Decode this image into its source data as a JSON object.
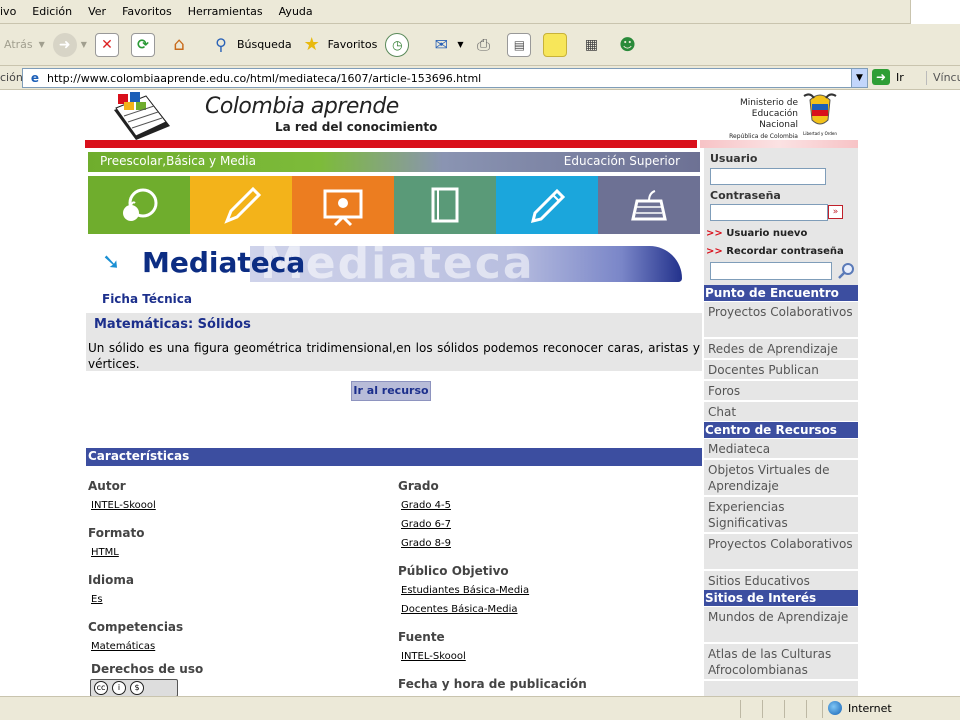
{
  "menu": [
    "ivo",
    "Edición",
    "Ver",
    "Favoritos",
    "Herramientas",
    "Ayuda"
  ],
  "toolbar": {
    "back_label": "Atrás",
    "search_label": "Búsqueda",
    "favorites_label": "Favoritos"
  },
  "address": {
    "label": "ción",
    "url": "http://www.colombiaaprende.edu.co/html/mediateca/1607/article-153696.html",
    "go_label": "Ir",
    "links_label": "Víncul"
  },
  "header": {
    "site_title": "Colombia aprende",
    "site_subtitle": "La red del conocimiento",
    "ministry_lines": [
      "Ministerio de",
      "Educación Nacional",
      "República de Colombia"
    ],
    "crest_caption": "Libertad y Orden"
  },
  "nav": {
    "left_label": "Preescolar,Básica y Media",
    "right_label": "Educación Superior"
  },
  "mediateca_title": "Mediateca",
  "mediateca_ghost": "Mediateca",
  "ficha_label": "Ficha Técnica",
  "resource": {
    "title": "Matemáticas: Sólidos",
    "description": "Un sólido es una figura geométrica tridimensional,en los sólidos podemos reconocer caras, aristas y vértices.",
    "go_button": "Ir al recurso"
  },
  "characteristics": {
    "header": "Características",
    "left": [
      {
        "label": "Autor",
        "values": [
          "INTEL-Skoool"
        ]
      },
      {
        "label": "Formato",
        "values": [
          "HTML"
        ]
      },
      {
        "label": "Idioma",
        "values": [
          "Es"
        ]
      },
      {
        "label": "Competencias",
        "values": [
          "Matemáticas"
        ]
      },
      {
        "label": "Derechos de uso",
        "values": []
      }
    ],
    "right": [
      {
        "label": "Grado",
        "values": [
          "Grado 4-5",
          "Grado 6-7",
          "Grado 8-9"
        ]
      },
      {
        "label": "Público Objetivo",
        "values": [
          "Estudiantes Básica-Media",
          "Docentes Básica-Media"
        ]
      },
      {
        "label": "Fuente",
        "values": [
          "INTEL-Skoool"
        ]
      },
      {
        "label": "Fecha y hora de publicación",
        "values": []
      }
    ]
  },
  "sidebar": {
    "user_label": "Usuario",
    "password_label": "Contraseña",
    "new_user": "Usuario nuevo",
    "remember_password": "Recordar contraseña",
    "link_arrow": ">>",
    "sections": [
      {
        "title": "Punto de Encuentro",
        "items": [
          "Proyectos Colaborativos",
          "Redes de Aprendizaje",
          "Docentes Publican",
          "Foros",
          "Chat"
        ]
      },
      {
        "title": "Centro de Recursos",
        "items": [
          "Mediateca",
          "Objetos Virtuales de Aprendizaje",
          "Experiencias Significativas",
          "Proyectos Colaborativos",
          "Sitios Educativos"
        ]
      },
      {
        "title": "Sitios de Interés",
        "items": [
          "Mundos de Aprendizaje",
          "Atlas de las Culturas Afrocolombianas"
        ]
      }
    ]
  },
  "status": {
    "zone": "Internet"
  },
  "colors": {
    "accent_blue": "#3c4ea0",
    "header_red": "#d9101b",
    "title_navy": "#1c2f8c"
  }
}
